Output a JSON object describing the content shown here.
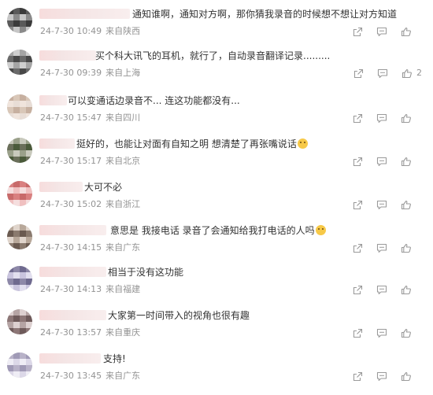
{
  "comments": [
    {
      "text": "通知谁啊，通知对方啊，那你猜我录音的时候想不想让对方知道",
      "time": "24-7-30 10:49",
      "location": "来自陕西",
      "likes": "",
      "emoji": false
    },
    {
      "text": "买个科大讯飞的耳机，就行了，自动录音翻译记录.........",
      "time": "24-7-30 09:39",
      "location": "来自上海",
      "likes": "2",
      "emoji": false
    },
    {
      "text": "可以变通话边录音不... 连这功能都没有...",
      "time": "24-7-30 15:47",
      "location": "来自四川",
      "likes": "",
      "emoji": false
    },
    {
      "text": "挺好的，也能让对面有自知之明 想清楚了再张嘴说话",
      "time": "24-7-30 15:17",
      "location": "来自北京",
      "likes": "",
      "emoji": true
    },
    {
      "text": "大可不必",
      "time": "24-7-30 15:02",
      "location": "来自浙江",
      "likes": "",
      "emoji": false
    },
    {
      "text": "意思是 我接电话 录音了会通知给我打电话的人吗",
      "time": "24-7-30 14:15",
      "location": "来自广东",
      "likes": "",
      "emoji": true
    },
    {
      "text": "相当于没有这功能",
      "time": "24-7-30 14:13",
      "location": "来自福建",
      "likes": "",
      "emoji": false
    },
    {
      "text": "大家第一时间带入的视角也很有趣",
      "time": "24-7-30 13:57",
      "location": "来自重庆",
      "likes": "",
      "emoji": false
    },
    {
      "text": "支持!",
      "time": "24-7-30 13:45",
      "location": "来自广东",
      "likes": "",
      "emoji": false
    }
  ],
  "icons": {
    "share": "share-icon",
    "reply": "comment-icon",
    "like": "thumbs-up-icon"
  },
  "colors": {
    "text": "#333333",
    "meta": "#939393",
    "icon": "#9a9a9a"
  }
}
